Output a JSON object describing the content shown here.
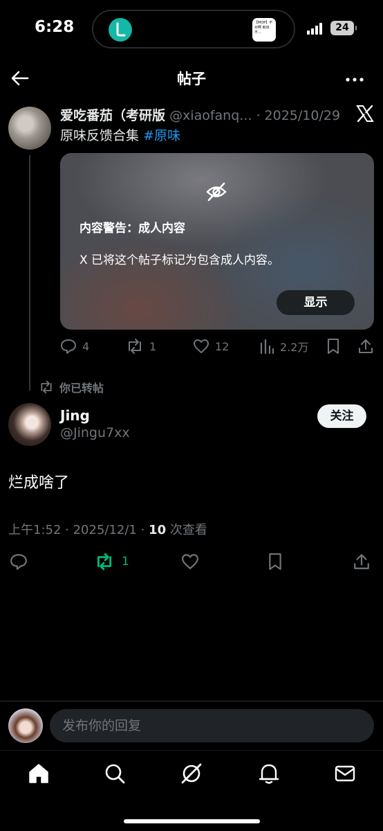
{
  "status_bar": {
    "time": "6:28",
    "battery": "24",
    "island_thumb_text": "【MOP】不对啊 就出不..."
  },
  "header": {
    "title": "帖子"
  },
  "quoted_post": {
    "author_name": "爱吃番茄（考研版",
    "handle": "@xiaofanq...",
    "date": "· 2025/10/29",
    "text": "原味反馈合集",
    "hashtag": "#原味",
    "content_warning": {
      "title": "内容警告：成人内容",
      "description": "X 已将这个帖子标记为包含成人内容。",
      "show_button": "显示"
    },
    "stats": {
      "replies": "4",
      "reposts": "1",
      "likes": "12",
      "views": "2.2万"
    }
  },
  "repost_notice": "你已转帖",
  "main_post": {
    "author_name": "Jing",
    "handle": "@Jingu7xx",
    "follow_label": "关注",
    "text": "烂成啥了",
    "meta_prefix": "上午1:52 · 2025/12/1 · ",
    "views_count": "10",
    "views_suffix": " 次查看",
    "reposts": "1"
  },
  "reply": {
    "placeholder": "发布你的回复"
  },
  "colors": {
    "accent": "#1d9bf0",
    "repost_green": "#00ba7c",
    "muted": "#71767b"
  },
  "tabs": [
    "home-icon",
    "search-icon",
    "grok-icon",
    "notifications-icon",
    "messages-icon"
  ]
}
